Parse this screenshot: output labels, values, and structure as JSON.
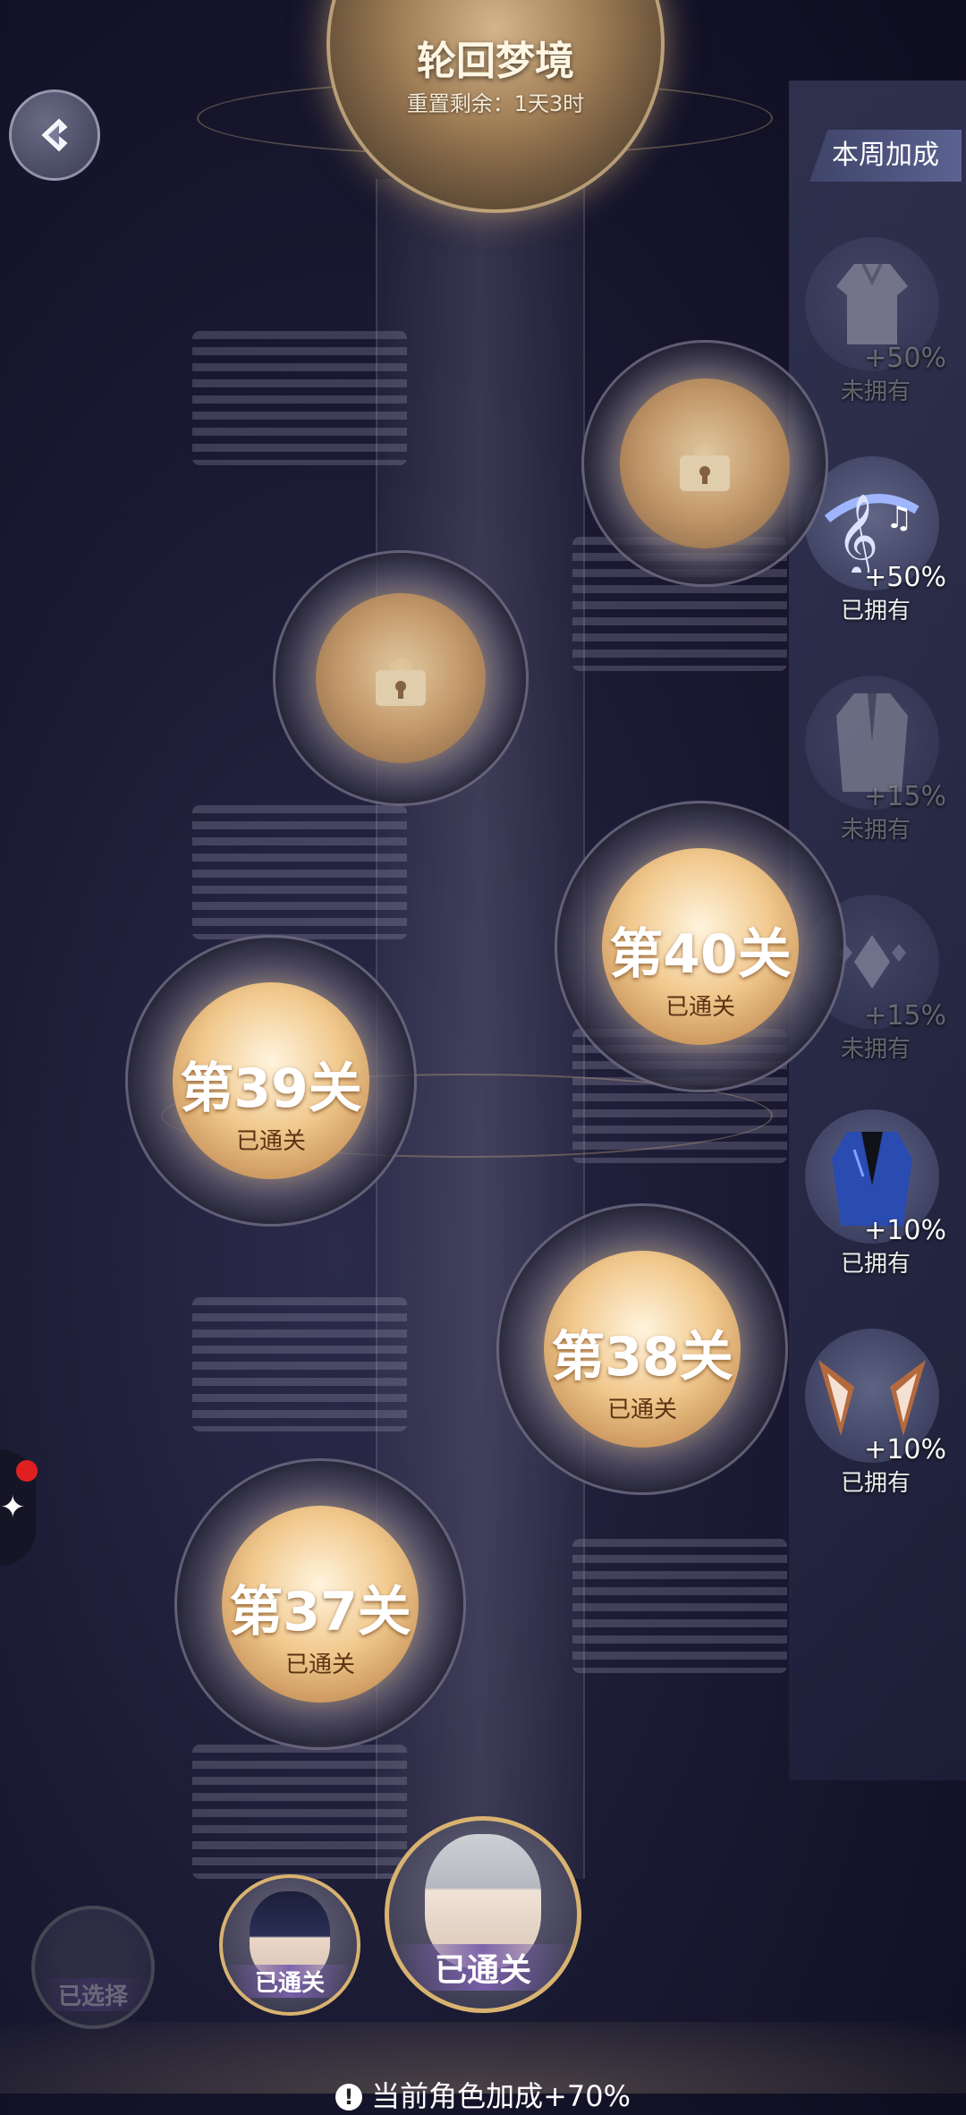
{
  "header": {
    "title": "轮回梦境",
    "reset_text": "重置剩余：1天3时"
  },
  "side_panel": {
    "tab_label": "本周加成",
    "items": [
      {
        "icon": "outfit-icon",
        "bonus": "+50%",
        "status": "未拥有",
        "owned": false
      },
      {
        "icon": "music-note-icon",
        "bonus": "+50%",
        "status": "已拥有",
        "owned": true
      },
      {
        "icon": "coat-icon",
        "bonus": "+15%",
        "status": "未拥有",
        "owned": false
      },
      {
        "icon": "diamond-icon",
        "bonus": "+15%",
        "status": "未拥有",
        "owned": false
      },
      {
        "icon": "blue-suit-icon",
        "bonus": "+10%",
        "status": "已拥有",
        "owned": true
      },
      {
        "icon": "fox-ears-icon",
        "bonus": "+10%",
        "status": "已拥有",
        "owned": true
      }
    ]
  },
  "levels": [
    {
      "title": "第40关",
      "status": "已通关"
    },
    {
      "title": "第39关",
      "status": "已通关"
    },
    {
      "title": "第38关",
      "status": "已通关"
    },
    {
      "title": "第37关",
      "status": "已通关"
    }
  ],
  "characters": {
    "left_label": "已选择",
    "mid_label": "已通关",
    "main_label": "已通关"
  },
  "bottom": {
    "bonus_text": "当前角色加成+70%"
  },
  "colors": {
    "accent_gold": "#d8b370",
    "panel_bg": "#3e4469",
    "notification_dot": "#e02020"
  }
}
